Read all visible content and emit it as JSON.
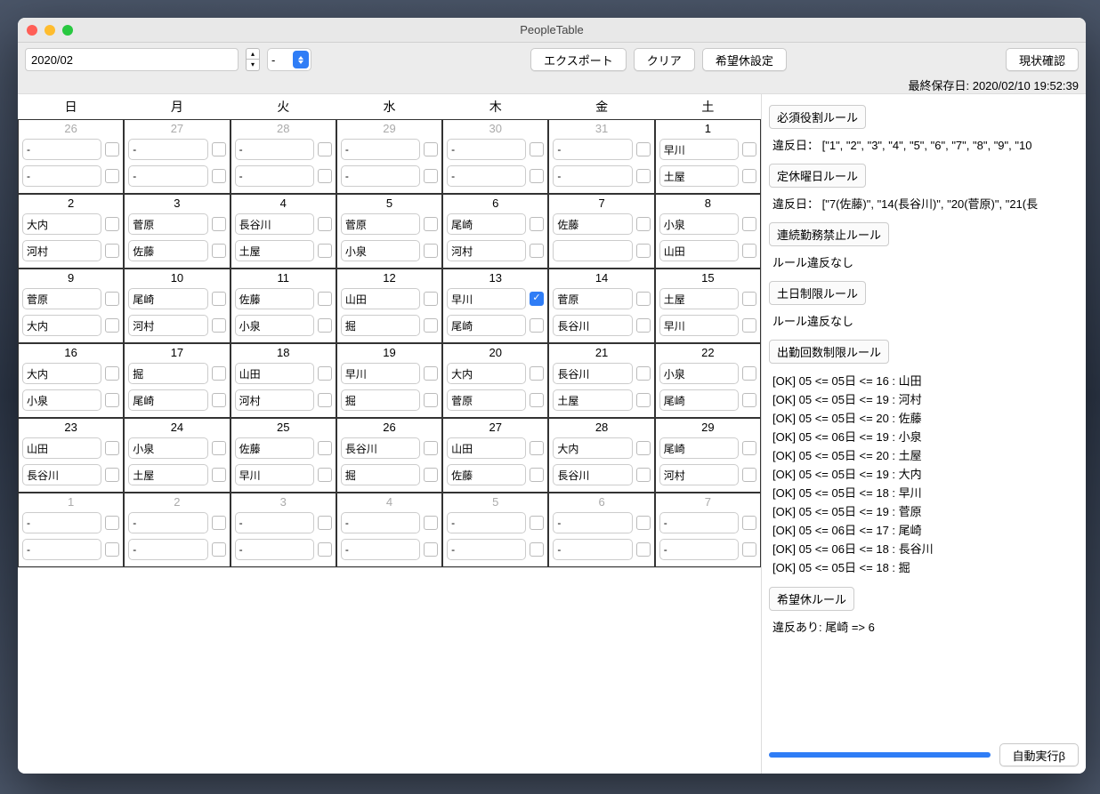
{
  "window": {
    "title": "PeopleTable"
  },
  "toolbar": {
    "date": "2020/02",
    "mini_select": "-",
    "export": "エクスポート",
    "clear": "クリア",
    "wish": "希望休設定",
    "check": "現状確認"
  },
  "last_saved": "最終保存日:  2020/02/10 19:52:39",
  "weekdays": [
    "日",
    "月",
    "火",
    "水",
    "木",
    "金",
    "土"
  ],
  "cells": [
    {
      "d": "26",
      "out": true,
      "s1": "-",
      "s2": "-"
    },
    {
      "d": "27",
      "out": true,
      "s1": "-",
      "s2": "-"
    },
    {
      "d": "28",
      "out": true,
      "s1": "-",
      "s2": "-"
    },
    {
      "d": "29",
      "out": true,
      "s1": "-",
      "s2": "-"
    },
    {
      "d": "30",
      "out": true,
      "s1": "-",
      "s2": "-"
    },
    {
      "d": "31",
      "out": true,
      "s1": "-",
      "s2": "-"
    },
    {
      "d": "1",
      "s1": "早川",
      "s2": "土屋"
    },
    {
      "d": "2",
      "s1": "大内",
      "s2": "河村"
    },
    {
      "d": "3",
      "s1": "菅原",
      "s2": "佐藤"
    },
    {
      "d": "4",
      "s1": "長谷川",
      "s2": "土屋"
    },
    {
      "d": "5",
      "s1": "菅原",
      "s2": "小泉"
    },
    {
      "d": "6",
      "s1": "尾崎",
      "s2": "河村"
    },
    {
      "d": "7",
      "s1": "佐藤",
      "s2": ""
    },
    {
      "d": "8",
      "s1": "小泉",
      "s2": "山田"
    },
    {
      "d": "9",
      "s1": "菅原",
      "s2": "大内"
    },
    {
      "d": "10",
      "s1": "尾崎",
      "s2": "河村"
    },
    {
      "d": "11",
      "s1": "佐藤",
      "s2": "小泉"
    },
    {
      "d": "12",
      "s1": "山田",
      "s2": "掘"
    },
    {
      "d": "13",
      "s1": "早川",
      "c1": true,
      "s2": "尾崎"
    },
    {
      "d": "14",
      "s1": "菅原",
      "s2": "長谷川"
    },
    {
      "d": "15",
      "s1": "土屋",
      "s2": "早川"
    },
    {
      "d": "16",
      "s1": "大内",
      "s2": "小泉"
    },
    {
      "d": "17",
      "s1": "掘",
      "s2": "尾崎"
    },
    {
      "d": "18",
      "s1": "山田",
      "s2": "河村"
    },
    {
      "d": "19",
      "s1": "早川",
      "s2": "掘"
    },
    {
      "d": "20",
      "s1": "大内",
      "s2": "菅原"
    },
    {
      "d": "21",
      "s1": "長谷川",
      "s2": "土屋"
    },
    {
      "d": "22",
      "s1": "小泉",
      "s2": "尾崎"
    },
    {
      "d": "23",
      "s1": "山田",
      "s2": "長谷川"
    },
    {
      "d": "24",
      "s1": "小泉",
      "s2": "土屋"
    },
    {
      "d": "25",
      "s1": "佐藤",
      "s2": "早川"
    },
    {
      "d": "26",
      "s1": "長谷川",
      "s2": "掘"
    },
    {
      "d": "27",
      "s1": "山田",
      "s2": "佐藤"
    },
    {
      "d": "28",
      "s1": "大内",
      "s2": "長谷川"
    },
    {
      "d": "29",
      "s1": "尾崎",
      "s2": "河村"
    },
    {
      "d": "1",
      "out": true,
      "s1": "-",
      "s2": "-"
    },
    {
      "d": "2",
      "out": true,
      "s1": "-",
      "s2": "-"
    },
    {
      "d": "3",
      "out": true,
      "s1": "-",
      "s2": "-"
    },
    {
      "d": "4",
      "out": true,
      "s1": "-",
      "s2": "-"
    },
    {
      "d": "5",
      "out": true,
      "s1": "-",
      "s2": "-"
    },
    {
      "d": "6",
      "out": true,
      "s1": "-",
      "s2": "-"
    },
    {
      "d": "7",
      "out": true,
      "s1": "-",
      "s2": "-"
    }
  ],
  "rules": {
    "r1_title": "必須役割ルール",
    "r1_body": "違反日：  [\"1\", \"2\", \"3\", \"4\", \"5\", \"6\", \"7\", \"8\", \"9\", \"10",
    "r2_title": "定休曜日ルール",
    "r2_body": "違反日：  [\"7(佐藤)\", \"14(長谷川)\", \"20(菅原)\", \"21(長",
    "r3_title": "連続勤務禁止ルール",
    "r3_body": "ルール違反なし",
    "r4_title": "土日制限ルール",
    "r4_body": "ルール違反なし",
    "r5_title": "出勤回数制限ルール",
    "r5_lines": [
      "[OK] 05 <= 05日 <= 16 : 山田",
      "[OK] 05 <= 05日 <= 19 : 河村",
      "[OK] 05 <= 05日 <= 20 : 佐藤",
      "[OK] 05 <= 06日 <= 19 : 小泉",
      "[OK] 05 <= 05日 <= 20 : 土屋",
      "[OK] 05 <= 05日 <= 19 : 大内",
      "[OK] 05 <= 05日 <= 18 : 早川",
      "[OK] 05 <= 05日 <= 19 : 菅原",
      "[OK] 05 <= 06日 <= 17 : 尾崎",
      "[OK] 05 <= 06日 <= 18 : 長谷川",
      "[OK] 05 <= 05日 <= 18 : 掘"
    ],
    "r6_title": "希望休ルール",
    "r6_body": "違反あり: 尾崎 => 6"
  },
  "auto_run": "自動実行β"
}
